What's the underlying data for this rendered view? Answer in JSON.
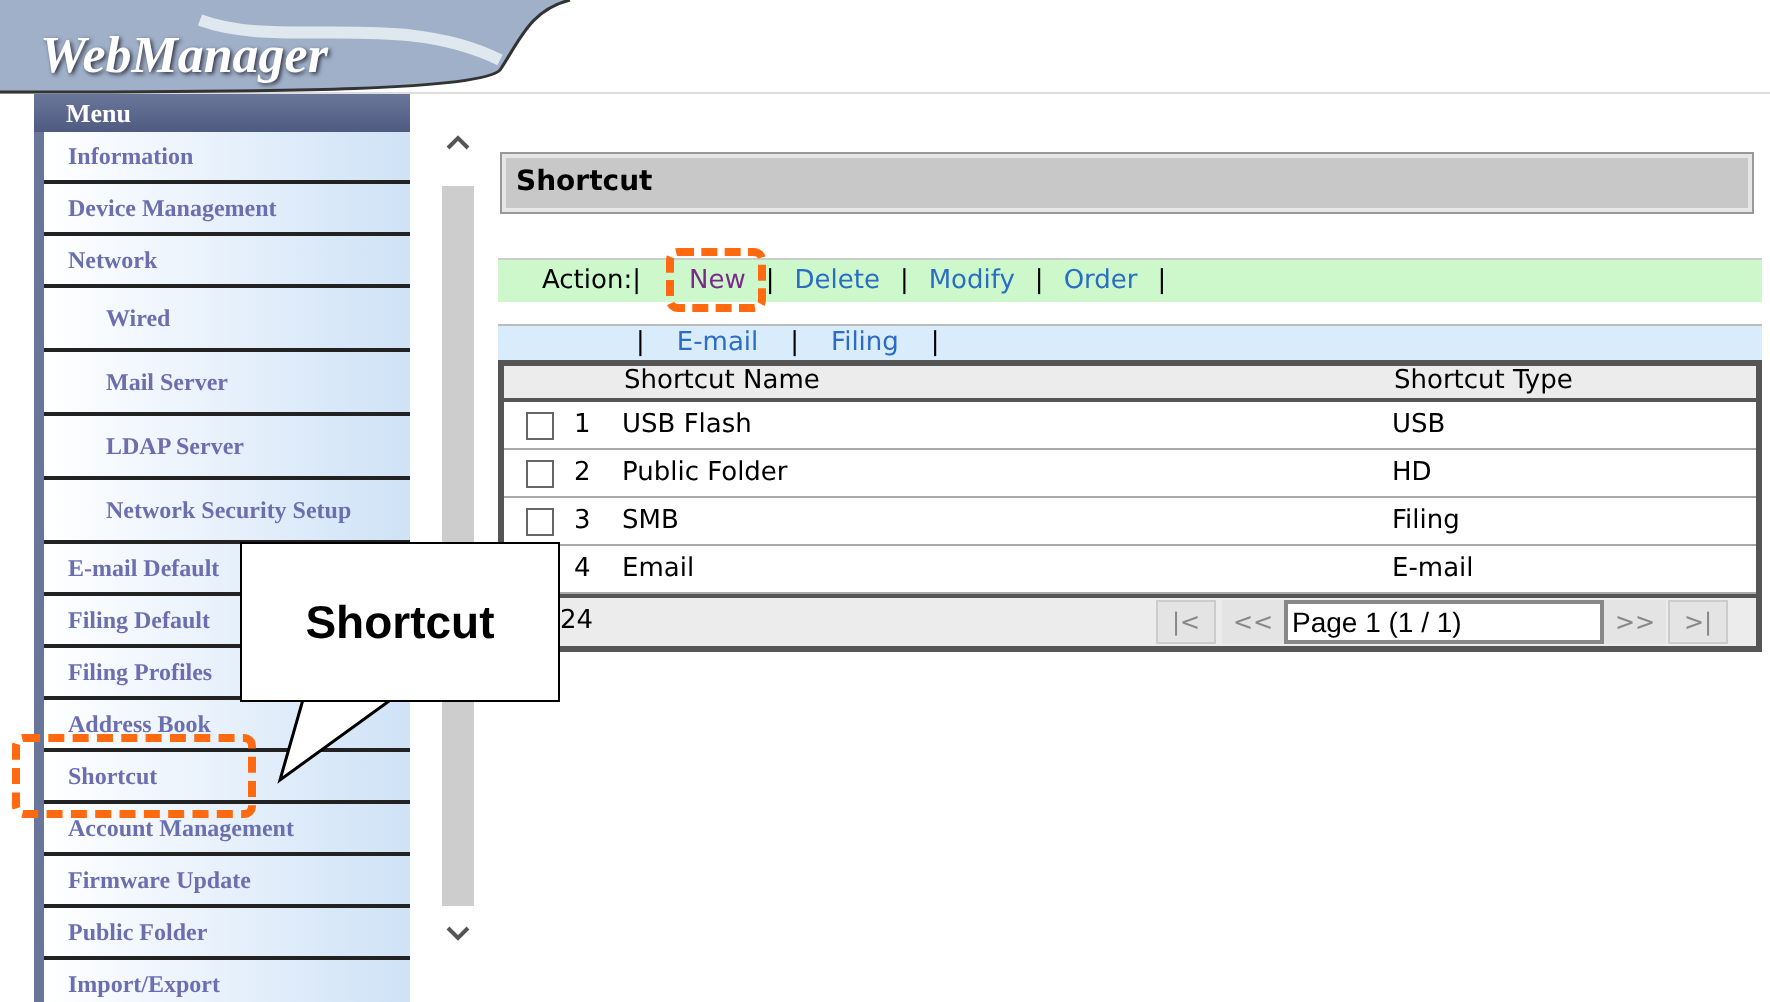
{
  "header": {
    "logo": "WebManager"
  },
  "sidebar": {
    "title": "Menu",
    "items": [
      {
        "label": "Information"
      },
      {
        "label": "Device Management"
      },
      {
        "label": "Network",
        "children": [
          {
            "label": "Wired"
          },
          {
            "label": "Mail Server"
          },
          {
            "label": "LDAP Server"
          },
          {
            "label": "Network Security Setup"
          }
        ]
      },
      {
        "label": "E-mail Default"
      },
      {
        "label": "Filing Default"
      },
      {
        "label": "Filing Profiles"
      },
      {
        "label": "Address Book"
      },
      {
        "label": "Shortcut"
      },
      {
        "label": "Account Management"
      },
      {
        "label": "Firmware Update"
      },
      {
        "label": "Public Folder"
      },
      {
        "label": "Import/Export"
      }
    ]
  },
  "page_title": "Shortcut",
  "actions": {
    "label": "Action:",
    "separator": "|",
    "links": [
      {
        "label": "New",
        "visited": true
      },
      {
        "label": "Delete",
        "visited": false
      },
      {
        "label": "Modify",
        "visited": false
      },
      {
        "label": "Order",
        "visited": false
      }
    ]
  },
  "filters": [
    "E-mail",
    "Filing"
  ],
  "table": {
    "columns": [
      "Shortcut Name",
      "Shortcut Type"
    ],
    "rows": [
      {
        "index": "1",
        "name": "USB Flash",
        "type": "USB",
        "checked": false
      },
      {
        "index": "2",
        "name": "Public Folder",
        "type": "HD",
        "checked": false
      },
      {
        "index": "3",
        "name": "SMB",
        "type": "Filing",
        "checked": false
      },
      {
        "index": "4",
        "name": "Email",
        "type": "E-mail"
      }
    ]
  },
  "pager": {
    "count": "24",
    "first": "|<",
    "prev": "<<",
    "page": "Page 1 (1 / 1)",
    "next": ">>",
    "last": ">|"
  },
  "callout": {
    "text": "Shortcut"
  }
}
